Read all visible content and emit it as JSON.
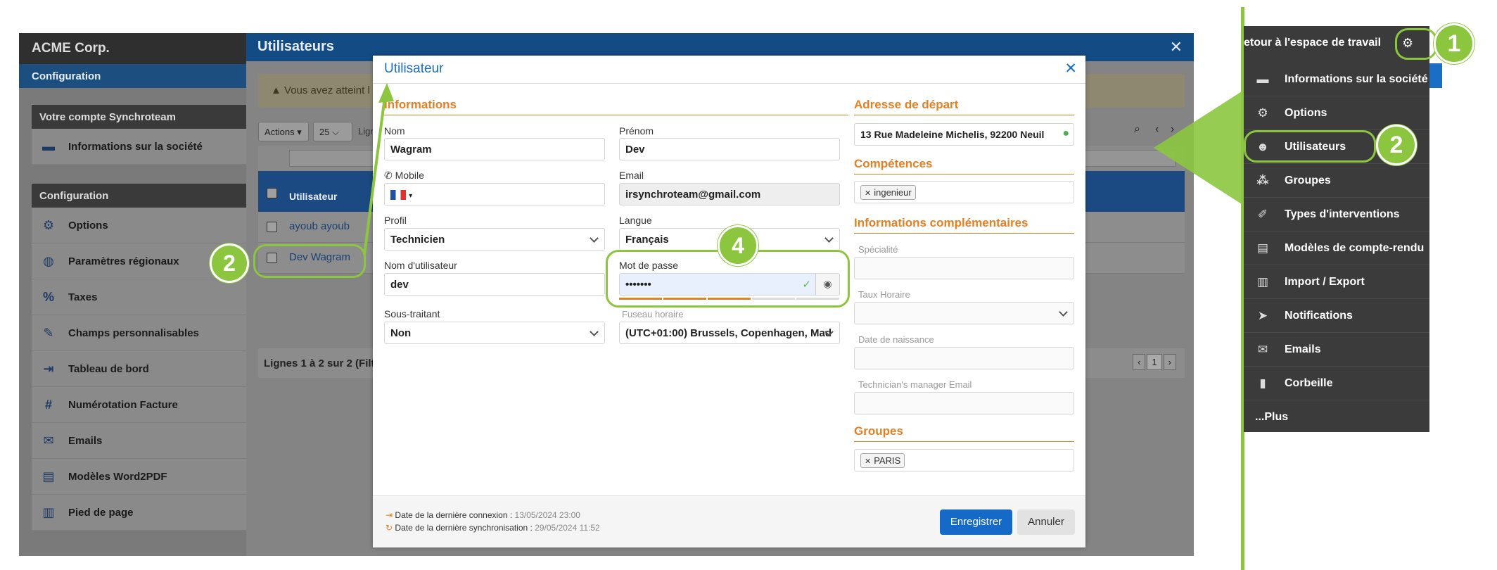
{
  "app": {
    "brand": "ACME Corp.",
    "config_bar": "Configuration",
    "account_section": {
      "header": "Votre compte Synchroteam",
      "items": [
        {
          "label": "Informations sur la société",
          "icon": "id-card-icon"
        }
      ]
    },
    "config_section": {
      "header": "Configuration",
      "items": [
        {
          "label": "Options",
          "icon": "gear-icon"
        },
        {
          "label": "Paramètres régionaux",
          "icon": "globe-icon"
        },
        {
          "label": "Taxes",
          "icon": "percent-icon"
        },
        {
          "label": "Champs personnalisables",
          "icon": "edit-icon"
        },
        {
          "label": "Tableau de bord",
          "icon": "export-icon"
        },
        {
          "label": "Numérotation Facture",
          "icon": "hash-icon"
        },
        {
          "label": "Emails",
          "icon": "mail-icon"
        },
        {
          "label": "Modèles Word2PDF",
          "icon": "pdf-file-icon"
        },
        {
          "label": "Pied de page",
          "icon": "code-file-icon"
        }
      ]
    }
  },
  "users_page": {
    "title": "Utilisateurs",
    "warning": "Vous avez atteint l",
    "actions_label": "Actions",
    "page_size": "25",
    "lines_label": "Lign",
    "column_user": "Utilisateur",
    "rows": [
      "ayoub ayoub",
      "Dev Wagram"
    ],
    "footer": "Lignes 1 à 2 sur 2 (Filtr",
    "page_number": "1"
  },
  "modal": {
    "title": "Utilisateur",
    "sections": {
      "informations": "Informations",
      "adresse": "Adresse de départ",
      "competences": "Compétences",
      "infos_comp": "Informations complémentaires",
      "groupes": "Groupes"
    },
    "fields": {
      "nom": {
        "label": "Nom",
        "value": "Wagram"
      },
      "prenom": {
        "label": "Prénom",
        "value": "Dev"
      },
      "mobile": {
        "label": "Mobile",
        "value": ""
      },
      "email": {
        "label": "Email",
        "value": "irsynchroteam@gmail.com"
      },
      "profil": {
        "label": "Profil",
        "value": "Technicien"
      },
      "langue": {
        "label": "Langue",
        "value": "Français"
      },
      "username": {
        "label": "Nom d'utilisateur",
        "value": "dev"
      },
      "password": {
        "label": "Mot de passe",
        "value": "•••••••"
      },
      "sous_traitant": {
        "label": "Sous-traitant",
        "value": "Non"
      },
      "fuseau": {
        "label": "Fuseau horaire",
        "value": "(UTC+01:00) Brussels, Copenhagen, Mad"
      },
      "adresse": {
        "value": "13 Rue Madeleine Michelis, 92200 Neuil"
      },
      "competence_tag": "ingenieur",
      "specialite": {
        "label": "Spécialité",
        "value": ""
      },
      "taux": {
        "label": "Taux Horaire",
        "value": ""
      },
      "naissance": {
        "label": "Date de naissance",
        "value": ""
      },
      "manager_email": {
        "label": "Technician's manager Email",
        "value": ""
      },
      "groupe_tag": "PARIS"
    },
    "footer": {
      "last_login_label": "Date de la dernière connexion :",
      "last_login_value": "13/05/2024 23:00",
      "last_sync_label": "Date de la dernière synchronisation :",
      "last_sync_value": "29/05/2024 11:52",
      "save": "Enregistrer",
      "cancel": "Annuler"
    }
  },
  "right_menu": {
    "top_label": "etour à l'espace de travail",
    "items": [
      {
        "label": "Informations sur la société",
        "icon": "id-card-icon"
      },
      {
        "label": "Options",
        "icon": "gear-icon"
      },
      {
        "label": "Utilisateurs",
        "icon": "user-edit-icon"
      },
      {
        "label": "Groupes",
        "icon": "users-icon"
      },
      {
        "label": "Types d'interventions",
        "icon": "wrench-icon"
      },
      {
        "label": "Modèles de compte-rendu",
        "icon": "file-edit-icon"
      },
      {
        "label": "Import / Export",
        "icon": "csv-file-icon"
      },
      {
        "label": "Notifications",
        "icon": "paper-plane-icon"
      },
      {
        "label": "Emails",
        "icon": "mail-icon"
      },
      {
        "label": "Corbeille",
        "icon": "trash-icon"
      },
      {
        "label": "...Plus",
        "icon": ""
      }
    ]
  },
  "callouts": {
    "one": "1",
    "two": "2",
    "four": "4"
  },
  "colors": {
    "accent_green": "#8cc63f",
    "section_orange": "#e67e22",
    "brand_blue": "#1569c7"
  }
}
